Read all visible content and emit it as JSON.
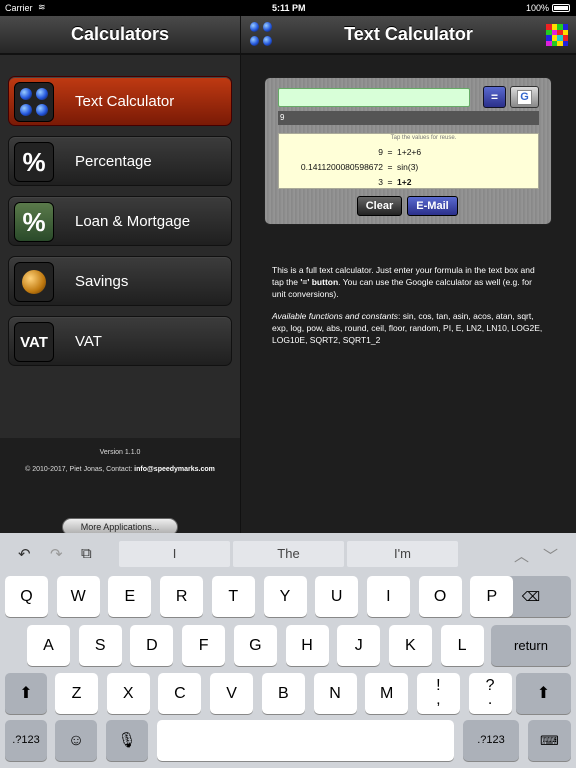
{
  "status": {
    "carrier": "Carrier",
    "time": "5:11 PM",
    "battery": "100%"
  },
  "left": {
    "title": "Calculators",
    "items": [
      {
        "label": "Text Calculator",
        "icon": "dots-icon"
      },
      {
        "label": "Percentage",
        "icon": "percent-icon",
        "icon_text": "%"
      },
      {
        "label": "Loan & Mortgage",
        "icon": "percent-green-icon",
        "icon_text": "%"
      },
      {
        "label": "Savings",
        "icon": "coin-icon"
      },
      {
        "label": "VAT",
        "icon": "vat-icon",
        "icon_text": "VAT"
      }
    ],
    "version": "Version 1.1.0",
    "copyright": "© 2010-2017, Piet Jonas, Contact: ",
    "contact": "info@speedymarks.com",
    "more_apps": "More Applications..."
  },
  "right": {
    "title": "Text Calculator",
    "formula_value": "",
    "equals_label": "=",
    "google_label": "G",
    "result": "9",
    "hint": "Tap the values for reuse.",
    "history": [
      {
        "value": "9",
        "eq": "=",
        "expr": "1+2+6"
      },
      {
        "value": "0.1411200080598672",
        "eq": "=",
        "expr": "sin(3)"
      },
      {
        "value": "3",
        "eq": "=",
        "expr": "1+2"
      }
    ],
    "clear_label": "Clear",
    "email_label": "E-Mail",
    "desc_a": "This is a full text calculator. Just enter your formula in the text box and tap the ",
    "desc_b": "'=' button",
    "desc_c": ". You can use the Google calculator as well (e.g. for unit conversions).",
    "funcs_title": "Available functions and constants",
    "funcs": ": sin, cos, tan, asin, acos, atan, sqrt, exp, log, pow, abs, round, ceil, floor, random, PI, E, LN2, LN10, LOG2E, LOG10E, SQRT2, SQRT1_2"
  },
  "keyboard": {
    "suggestions": [
      "I",
      "The",
      "I'm"
    ],
    "row1": [
      "Q",
      "W",
      "E",
      "R",
      "T",
      "Y",
      "U",
      "I",
      "O",
      "P"
    ],
    "row2": [
      "A",
      "S",
      "D",
      "F",
      "G",
      "H",
      "J",
      "K",
      "L"
    ],
    "return_label": "return",
    "row3": [
      "Z",
      "X",
      "C",
      "V",
      "B",
      "N",
      "M",
      "!\n,",
      "?\n."
    ],
    "num_label": ".?123"
  }
}
